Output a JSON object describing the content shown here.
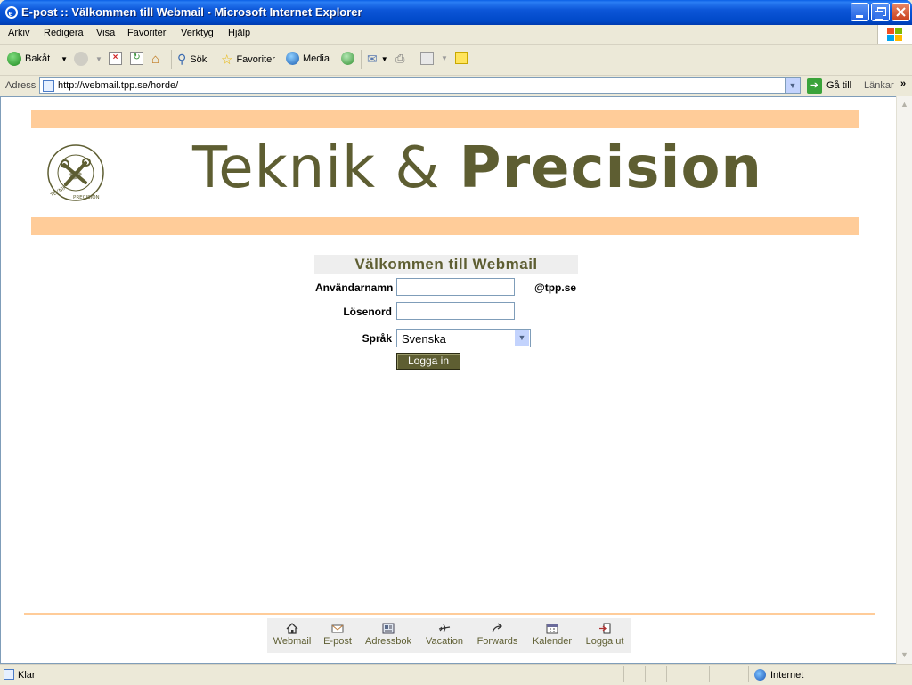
{
  "window": {
    "title": "E-post :: Välkommen till Webmail - Microsoft Internet Explorer"
  },
  "menu": [
    "Arkiv",
    "Redigera",
    "Visa",
    "Favoriter",
    "Verktyg",
    "Hjälp"
  ],
  "toolbar": {
    "back": "Bakåt",
    "search": "Sök",
    "favorites": "Favoriter",
    "media": "Media"
  },
  "address": {
    "label": "Adress",
    "url": "http://webmail.tpp.se/horde/",
    "go": "Gå till",
    "links": "Länkar"
  },
  "page": {
    "brand_thin": "Teknik & ",
    "brand_bold": "Precision",
    "welcome": "Välkommen till Webmail",
    "username_label": "Användarnamn",
    "username_value": "",
    "domain_suffix": "@tpp.se",
    "password_label": "Lösenord",
    "password_value": "",
    "language_label": "Språk",
    "language_value": "Svenska",
    "login_button": "Logga in"
  },
  "footer_nav": [
    {
      "label": "Webmail",
      "icon": "house-icon"
    },
    {
      "label": "E-post",
      "icon": "envelope-icon"
    },
    {
      "label": "Adressbok",
      "icon": "addressbook-icon"
    },
    {
      "label": "Vacation",
      "icon": "plane-icon"
    },
    {
      "label": "Forwards",
      "icon": "forward-icon"
    },
    {
      "label": "Kalender",
      "icon": "calendar-icon"
    },
    {
      "label": "Logga ut",
      "icon": "logout-icon"
    }
  ],
  "status": {
    "text": "Klar",
    "zone": "Internet"
  },
  "colors": {
    "accent_orange": "#ffcc99",
    "brand_olive": "#5e5e32"
  }
}
